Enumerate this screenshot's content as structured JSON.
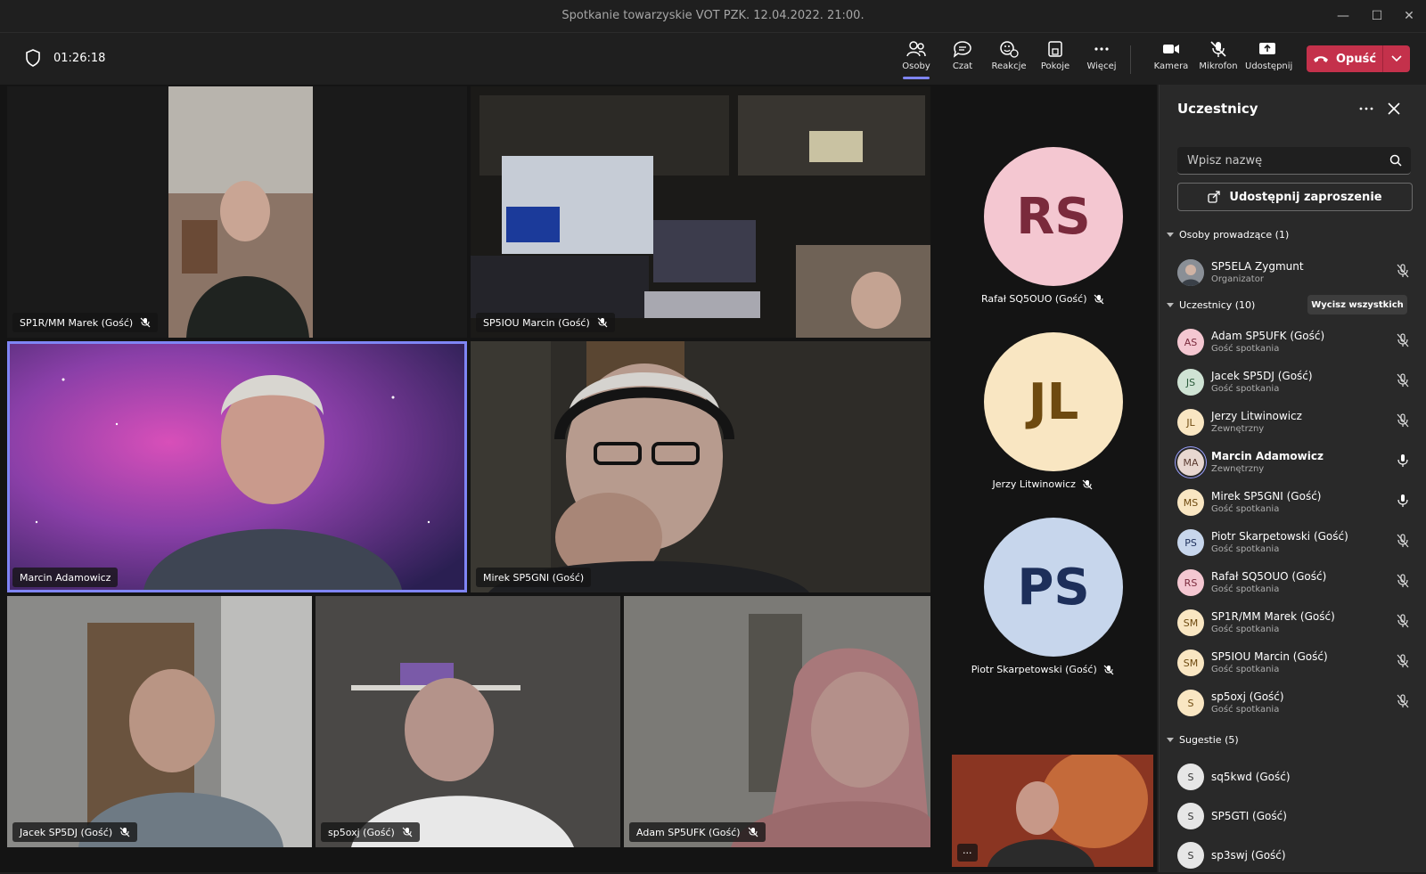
{
  "window": {
    "title": "Spotkanie towarzyskie VOT PZK. 12.04.2022. 21:00."
  },
  "toolbar": {
    "timer": "01:26:18",
    "buttons": {
      "people": "Osoby",
      "chat": "Czat",
      "reactions": "Reakcje",
      "rooms": "Pokoje",
      "more": "Więcej",
      "camera": "Kamera",
      "mic": "Mikrofon",
      "share": "Udostępnij"
    },
    "leave": "Opuść"
  },
  "stage": {
    "tiles": [
      {
        "name": "SP1R/MM Marek (Gość)"
      },
      {
        "name": "SP5IOU Marcin (Gość)"
      },
      {
        "name": "Marcin Adamowicz"
      },
      {
        "name": "Mirek SP5GNI (Gość)"
      },
      {
        "name": "Jacek SP5DJ (Gość)"
      },
      {
        "name": "sp5oxj (Gość)"
      },
      {
        "name": "Adam SP5UFK (Gość)"
      }
    ],
    "avatars": [
      {
        "initials": "RS",
        "name": "Rafał SQ5OUO (Gość)"
      },
      {
        "initials": "JL",
        "name": "Jerzy Litwinowicz"
      },
      {
        "initials": "PS",
        "name": "Piotr Skarpetowski (Gość)"
      }
    ],
    "self_more": "···"
  },
  "panel": {
    "title": "Uczestnicy",
    "search_placeholder": "Wpisz nazwę",
    "share_invite": "Udostępnij zaproszenie",
    "organizers_header": "Osoby prowadzące (1)",
    "organizer": {
      "name": "SP5ELA Zygmunt",
      "role": "Organizator"
    },
    "participants_header": "Uczestnicy (10)",
    "mute_all": "Wycisz wszystkich",
    "participants": [
      {
        "initials": "AS",
        "name": "Adam SP5UFK (Gość)",
        "role": "Gość spotkania",
        "muted": true
      },
      {
        "initials": "JS",
        "name": "Jacek SP5DJ (Gość)",
        "role": "Gość spotkania",
        "muted": true
      },
      {
        "initials": "JL",
        "name": "Jerzy Litwinowicz",
        "role": "Zewnętrzny",
        "muted": true
      },
      {
        "initials": "MA",
        "name": "Marcin Adamowicz",
        "role": "Zewnętrzny",
        "muted": false
      },
      {
        "initials": "MS",
        "name": "Mirek SP5GNI (Gość)",
        "role": "Gość spotkania",
        "muted": false
      },
      {
        "initials": "PS",
        "name": "Piotr Skarpetowski (Gość)",
        "role": "Gość spotkania",
        "muted": true
      },
      {
        "initials": "RS",
        "name": "Rafał SQ5OUO (Gość)",
        "role": "Gość spotkania",
        "muted": true
      },
      {
        "initials": "SM",
        "name": "SP1R/MM Marek (Gość)",
        "role": "Gość spotkania",
        "muted": true
      },
      {
        "initials": "SM",
        "name": "SP5IOU Marcin (Gość)",
        "role": "Gość spotkania",
        "muted": true
      },
      {
        "initials": "S",
        "name": "sp5oxj (Gość)",
        "role": "Gość spotkania",
        "muted": true
      }
    ],
    "suggestions_header": "Sugestie (5)",
    "suggestions": [
      {
        "initials": "S",
        "name": "sq5kwd (Gość)"
      },
      {
        "initials": "S",
        "name": "SP5GTI (Gość)"
      },
      {
        "initials": "S",
        "name": "sp3swj (Gość)"
      }
    ]
  },
  "colors": {
    "accent": "#7f85f5",
    "leave": "#c4314b",
    "panel": "#292929"
  }
}
